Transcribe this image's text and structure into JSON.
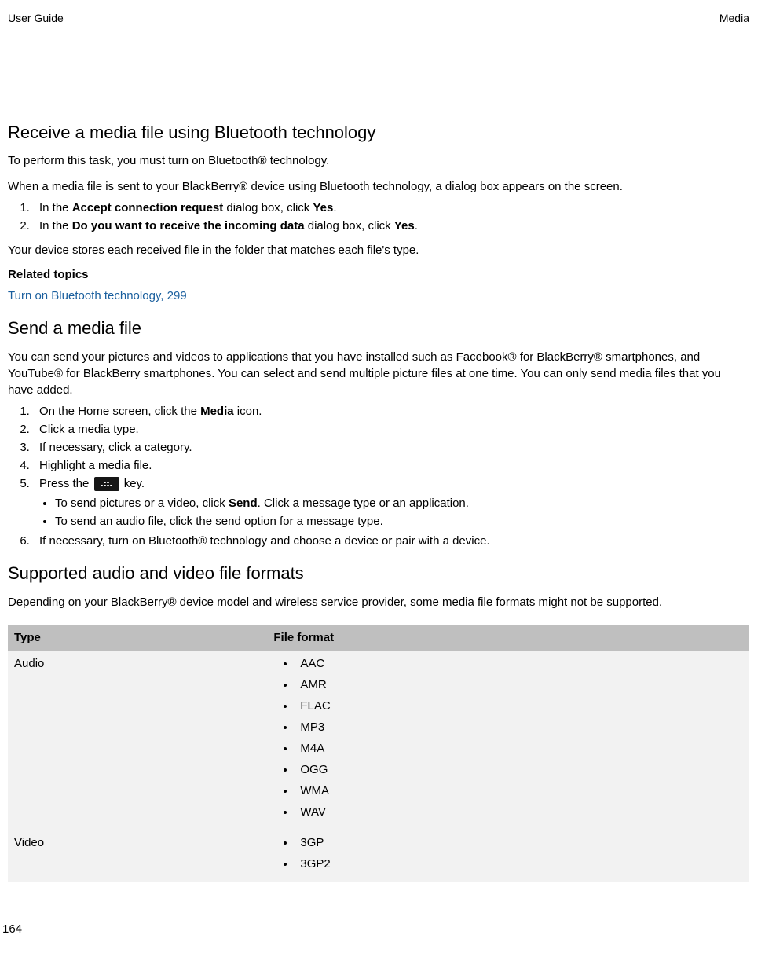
{
  "header": {
    "left": "User Guide",
    "right": "Media"
  },
  "section1": {
    "heading": "Receive a media file using Bluetooth technology",
    "intro": "To perform this task, you must turn on Bluetooth® technology.",
    "para1": "When a media file is sent to your BlackBerry® device using Bluetooth technology, a dialog box appears on the screen.",
    "step1_a": "In the ",
    "step1_b": "Accept connection request",
    "step1_c": " dialog box, click ",
    "step1_d": "Yes",
    "step1_e": ".",
    "step2_a": "In the ",
    "step2_b": "Do you want to receive the incoming data",
    "step2_c": " dialog box, click ",
    "step2_d": "Yes",
    "step2_e": ".",
    "para2": "Your device stores each received file in the folder that matches each file's type.",
    "related_heading": "Related topics",
    "related_link": "Turn on Bluetooth technology, 299"
  },
  "section2": {
    "heading": "Send a media file",
    "intro": "You can send your pictures and videos to applications that you have installed such as Facebook® for BlackBerry® smartphones, and YouTube® for BlackBerry smartphones. You can select and send multiple picture files at one time. You can only send media files that you have added.",
    "step1_a": "On the Home screen, click the ",
    "step1_b": "Media",
    "step1_c": " icon.",
    "step2": "Click a media type.",
    "step3": "If necessary, click a category.",
    "step4": "Highlight a media file.",
    "step5_a": "Press the ",
    "step5_b": " key.",
    "bullet1_a": "To send pictures or a video, click ",
    "bullet1_b": "Send",
    "bullet1_c": ". Click a message type or an application.",
    "bullet2": "To send an audio file, click the send option for a message type.",
    "step6": "If necessary, turn on Bluetooth® technology and choose a device or pair with a device."
  },
  "section3": {
    "heading": "Supported audio and video file formats",
    "intro": "Depending on your BlackBerry® device model and wireless service provider, some media file formats might not be supported.",
    "table": {
      "col1": "Type",
      "col2": "File format",
      "row1_type": "Audio",
      "row1_items": [
        "AAC",
        "AMR",
        "FLAC",
        "MP3",
        "M4A",
        "OGG",
        "WMA",
        "WAV"
      ],
      "row2_type": "Video",
      "row2_items": [
        "3GP",
        "3GP2"
      ]
    }
  },
  "footer": {
    "page": "164"
  }
}
